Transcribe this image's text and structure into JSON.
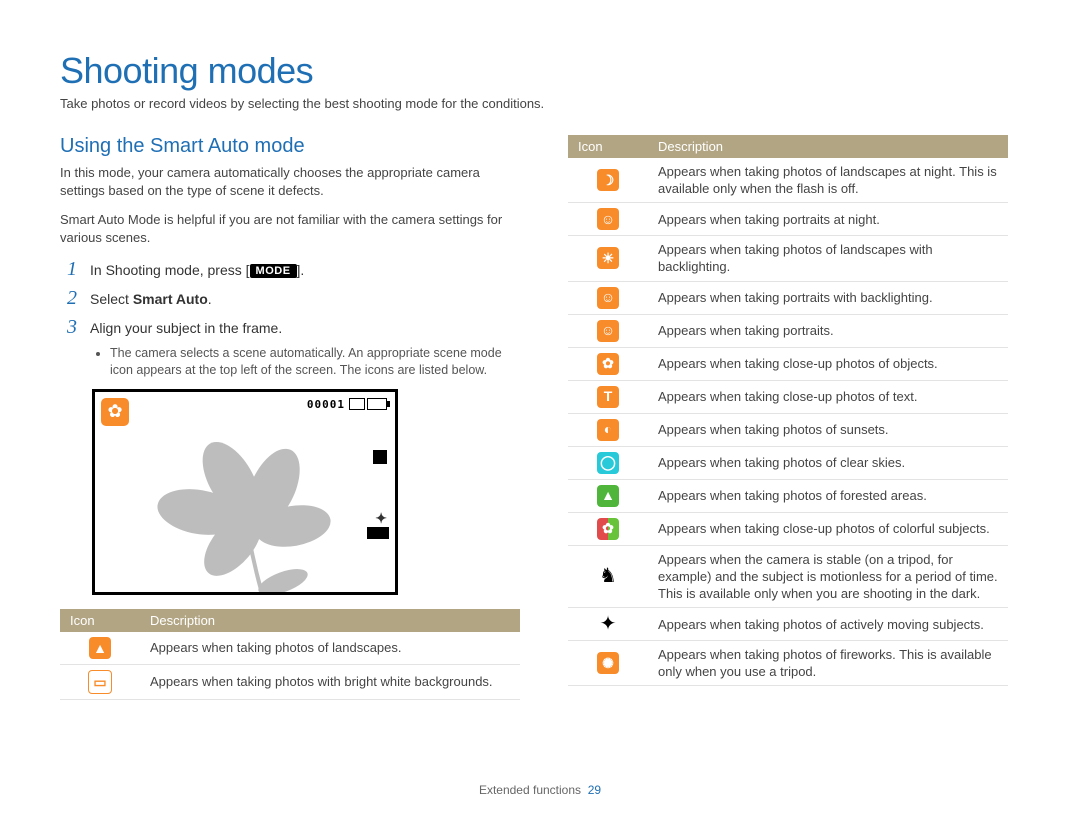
{
  "title": "Shooting modes",
  "subtitle": "Take photos or record videos by selecting the best shooting mode for the conditions.",
  "section": {
    "heading": "Using the Smart Auto mode",
    "para1": "In this mode, your camera automatically chooses the appropriate camera settings based on the type of scene it defects.",
    "para2": "Smart Auto Mode is helpful if you are not familiar with the camera settings for various scenes."
  },
  "steps": [
    {
      "num": "1",
      "before": "In Shooting mode, press [",
      "badge": "MODE",
      "after": "]."
    },
    {
      "num": "2",
      "text": "Select ",
      "bold": "Smart Auto",
      "after": "."
    },
    {
      "num": "3",
      "text": "Align your subject in the frame."
    }
  ],
  "bullet": "The camera selects a scene automatically. An appropriate scene mode icon appears at the top left of the screen. The icons are listed below.",
  "lcd": {
    "counter": "00001",
    "corner_icon": "✿"
  },
  "table_headers": {
    "icon": "Icon",
    "desc": "Description"
  },
  "left_icons": [
    {
      "name": "landscape-icon",
      "glyph": "▲",
      "cls": "ic-orange",
      "desc": "Appears when taking photos of landscapes."
    },
    {
      "name": "white-bg-icon",
      "glyph": "▭",
      "cls": "ic-white",
      "desc": "Appears when taking photos with bright white backgrounds."
    }
  ],
  "right_icons": [
    {
      "name": "night-landscape-icon",
      "glyph": "☽",
      "cls": "ic-orange",
      "desc": "Appears when taking photos of landscapes at night. This is available only when the flash is off."
    },
    {
      "name": "night-portrait-icon",
      "glyph": "☺",
      "cls": "ic-orange",
      "desc": "Appears when taking portraits at night."
    },
    {
      "name": "backlit-landscape-icon",
      "glyph": "☀",
      "cls": "ic-orange",
      "desc": "Appears when taking photos of landscapes with backlighting."
    },
    {
      "name": "backlit-portrait-icon",
      "glyph": "☺",
      "cls": "ic-orange",
      "desc": "Appears when taking portraits with backlighting."
    },
    {
      "name": "portrait-icon",
      "glyph": "☺",
      "cls": "ic-orange",
      "desc": "Appears when taking portraits."
    },
    {
      "name": "macro-object-icon",
      "glyph": "✿",
      "cls": "ic-orange",
      "desc": "Appears when taking close-up photos of objects."
    },
    {
      "name": "macro-text-icon",
      "glyph": "T",
      "cls": "ic-orange",
      "desc": "Appears when taking close-up photos of text."
    },
    {
      "name": "sunset-icon",
      "glyph": "◐",
      "cls": "ic-orange",
      "desc": "Appears when taking photos of sunsets."
    },
    {
      "name": "clear-sky-icon",
      "glyph": "◯",
      "cls": "ic-cyan",
      "desc": "Appears when taking photos of clear skies."
    },
    {
      "name": "forest-icon",
      "glyph": "▲",
      "cls": "ic-green",
      "desc": "Appears when taking photos of forested areas."
    },
    {
      "name": "macro-color-icon",
      "glyph": "✿",
      "cls": "ic-half",
      "desc": "Appears when taking close-up photos of colorful subjects."
    },
    {
      "name": "tripod-icon",
      "glyph": "♞",
      "cls": "ic-black",
      "desc": "Appears when the camera is stable (on a tripod, for example) and the subject is motionless for a period of time. This is available only when you are shooting in the dark."
    },
    {
      "name": "action-icon",
      "glyph": "✦",
      "cls": "ic-black",
      "desc": "Appears when taking photos of actively moving subjects."
    },
    {
      "name": "fireworks-icon",
      "glyph": "✺",
      "cls": "ic-orange",
      "desc": "Appears when taking photos of fireworks. This is available only when you use a tripod."
    }
  ],
  "footer": {
    "section": "Extended functions",
    "page": "29"
  }
}
